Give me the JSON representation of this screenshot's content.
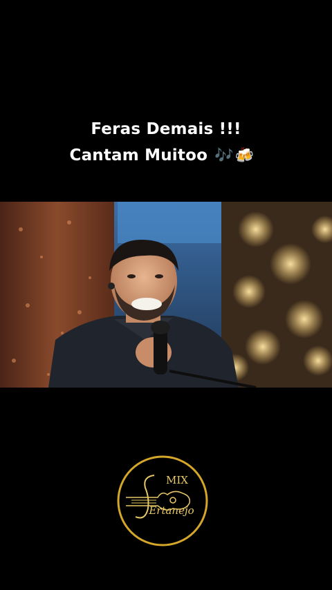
{
  "caption": {
    "line1": "Feras Demais !!!",
    "line2": "Cantam Muitoo",
    "emoji1": "🎶",
    "emoji2": "🍻"
  },
  "video": {
    "description_icon": "video-frame"
  },
  "logo": {
    "top_text": "MIX",
    "bottom_text": "Ertanejo",
    "ring_color": "#d4a62a",
    "text_color": "#e8c866"
  }
}
